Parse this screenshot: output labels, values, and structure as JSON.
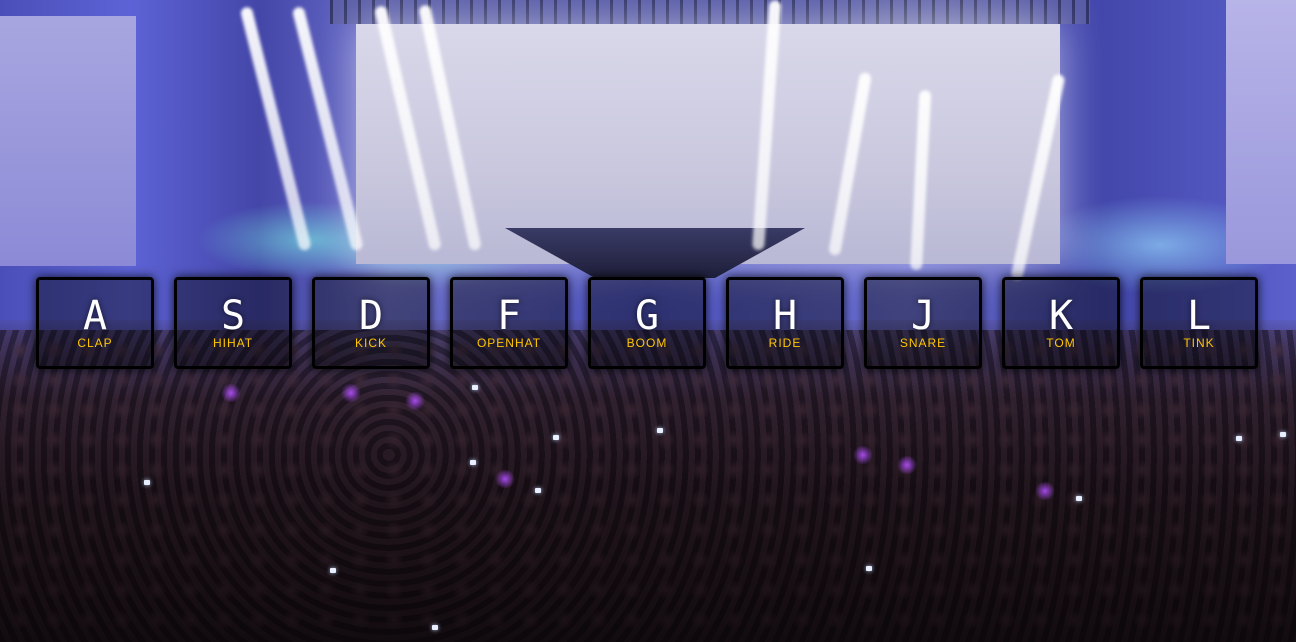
{
  "theme": {
    "accent": "#ffc600",
    "key_border": "#000000",
    "key_text": "#ffffff"
  },
  "keys": [
    {
      "letter": "A",
      "sound": "clap"
    },
    {
      "letter": "S",
      "sound": "hihat"
    },
    {
      "letter": "D",
      "sound": "kick"
    },
    {
      "letter": "F",
      "sound": "openhat"
    },
    {
      "letter": "G",
      "sound": "boom"
    },
    {
      "letter": "H",
      "sound": "ride"
    },
    {
      "letter": "J",
      "sound": "snare"
    },
    {
      "letter": "K",
      "sound": "tom"
    },
    {
      "letter": "L",
      "sound": "tink"
    }
  ]
}
